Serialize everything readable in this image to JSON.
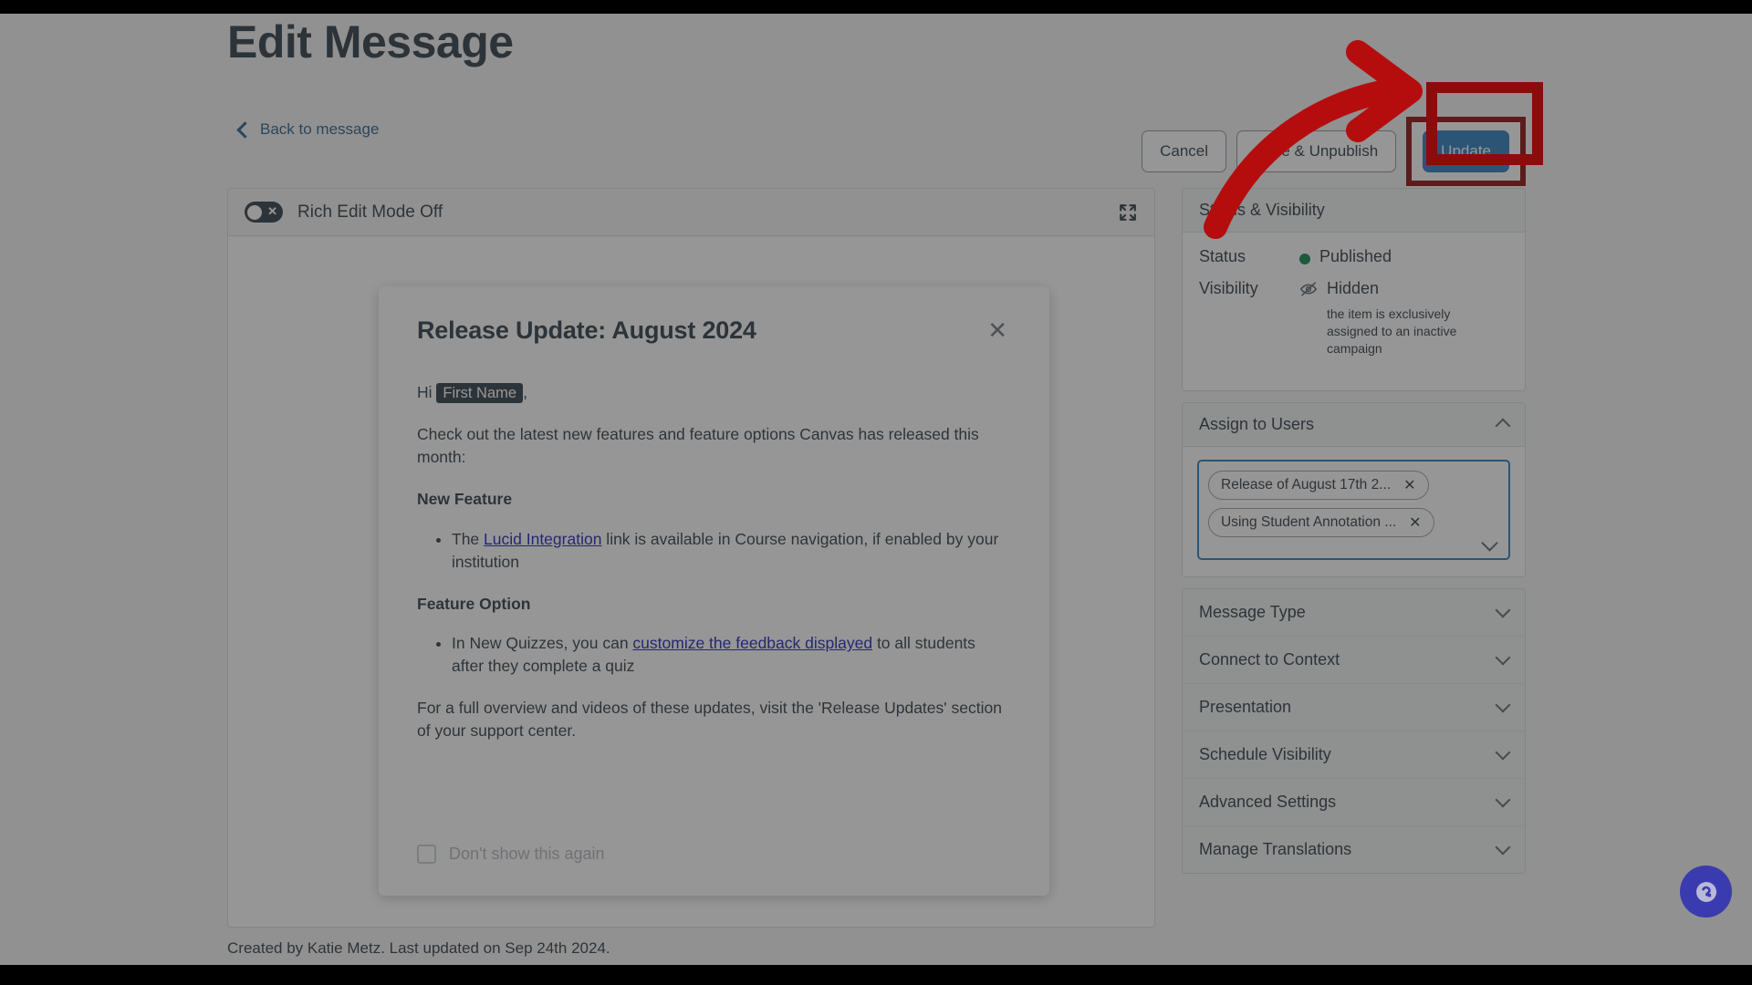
{
  "header": {
    "title": "Edit Message",
    "back_link": "Back to message"
  },
  "actions": {
    "cancel": "Cancel",
    "save_unpublish": "Save & Unpublish",
    "update": "Update"
  },
  "editor": {
    "rich_edit_toggle_label": "Rich Edit Mode Off",
    "expand_icon": "fullscreen-icon",
    "created_line": "Created by Katie Metz. Last updated on Sep 24th 2024."
  },
  "preview": {
    "title": "Release Update: August 2024",
    "close_icon": "close-icon",
    "greeting_prefix": "Hi ",
    "greeting_token": "First Name",
    "greeting_suffix": ",",
    "intro": "Check out the latest new features and feature options Canvas has released this month:",
    "section1_heading": "New Feature",
    "bullet1_before": "The ",
    "bullet1_link": "Lucid Integration",
    "bullet1_after": " link is available in Course navigation, if enabled by your institution",
    "section2_heading": "Feature Option",
    "bullet2_before": "In New Quizzes, you can ",
    "bullet2_link": "customize the feedback displayed",
    "bullet2_after": " to all students after they complete a quiz",
    "closing": "For a full overview and videos of these updates, visit the 'Release Updates' section of your support center.",
    "dont_show_label": "Don't show this again"
  },
  "sidebar": {
    "status_card": {
      "heading": "Status & Visibility",
      "status_label": "Status",
      "status_value": "Published",
      "status_color": "#0b874b",
      "visibility_label": "Visibility",
      "visibility_value": "Hidden",
      "visibility_icon": "eye-off-icon",
      "visibility_note": "the item is exclusively assigned to an inactive campaign"
    },
    "assign_card": {
      "heading": "Assign to Users",
      "collapse_icon": "chevron-up-icon",
      "tokens": [
        "Release of August 17th 2...",
        "Using Student Annotation ..."
      ],
      "remove_icon": "close-icon",
      "dropdown_icon": "chevron-down-icon"
    },
    "accordions": [
      {
        "label": "Message Type",
        "icon": "chevron-down-icon"
      },
      {
        "label": "Connect to Context",
        "icon": "chevron-down-icon"
      },
      {
        "label": "Presentation",
        "icon": "chevron-down-icon"
      },
      {
        "label": "Schedule Visibility",
        "icon": "chevron-down-icon"
      },
      {
        "label": "Advanced Settings",
        "icon": "chevron-down-icon"
      },
      {
        "label": "Manage Translations",
        "icon": "chevron-down-icon"
      }
    ]
  },
  "help": {
    "icon": "help-chat-icon",
    "color": "#3b3bb0"
  },
  "annotation": {
    "arrow_color": "#b50d0d",
    "highlight_color": "#8c0b0b",
    "target": "Update"
  }
}
